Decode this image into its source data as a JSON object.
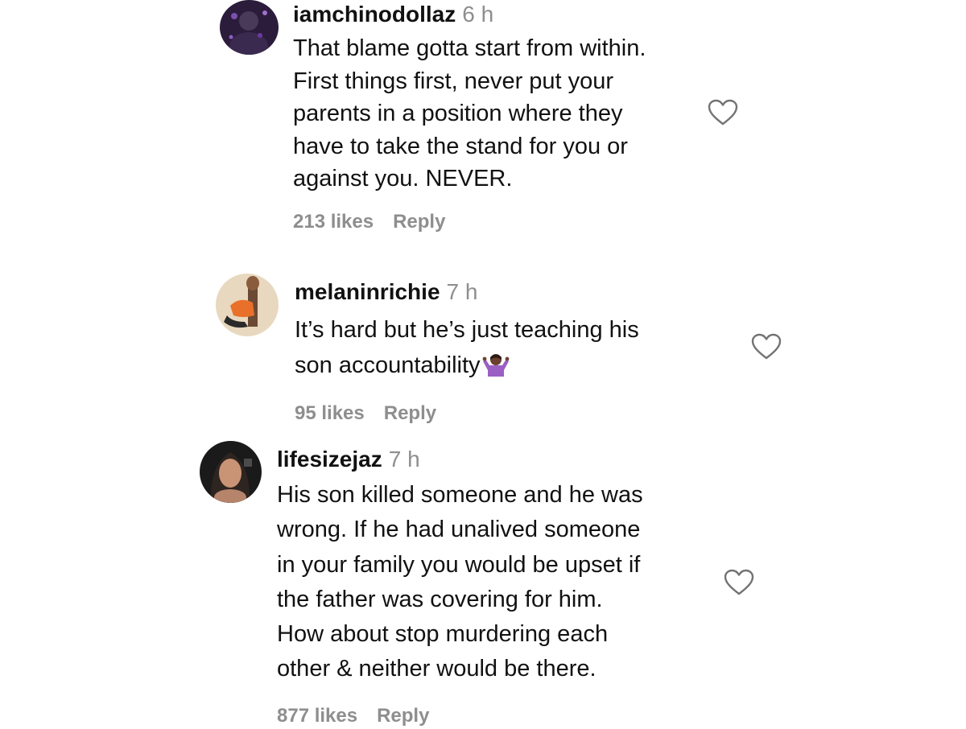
{
  "comments": [
    {
      "username": "iamchinodollaz",
      "time": "6 h",
      "text": "That blame gotta start from within.\nFirst things first, never put your\nparents in a position where they\nhave to take the stand for you or\nagainst you. NEVER.",
      "likes": "213 likes",
      "reply_label": "Reply",
      "avatar_icon": "profile-photo"
    },
    {
      "username": "melaninrichie",
      "time": "7 h",
      "text": "It’s hard but he’s just teaching his\nson accountability",
      "emoji_icon": "person-shrugging-emoji",
      "likes": "95 likes",
      "reply_label": "Reply",
      "avatar_icon": "profile-photo"
    },
    {
      "username": "lifesizejaz",
      "time": "7 h",
      "text": "His son killed someone and he was\nwrong. If he had unalived someone\nin your family you would be upset if\nthe father was covering for him.\nHow about stop murdering each\nother & neither would be there.",
      "likes": "877 likes",
      "reply_label": "Reply",
      "avatar_icon": "profile-photo"
    }
  ],
  "colors": {
    "text": "#111111",
    "secondary": "#8e8e8e",
    "background": "#ffffff"
  }
}
